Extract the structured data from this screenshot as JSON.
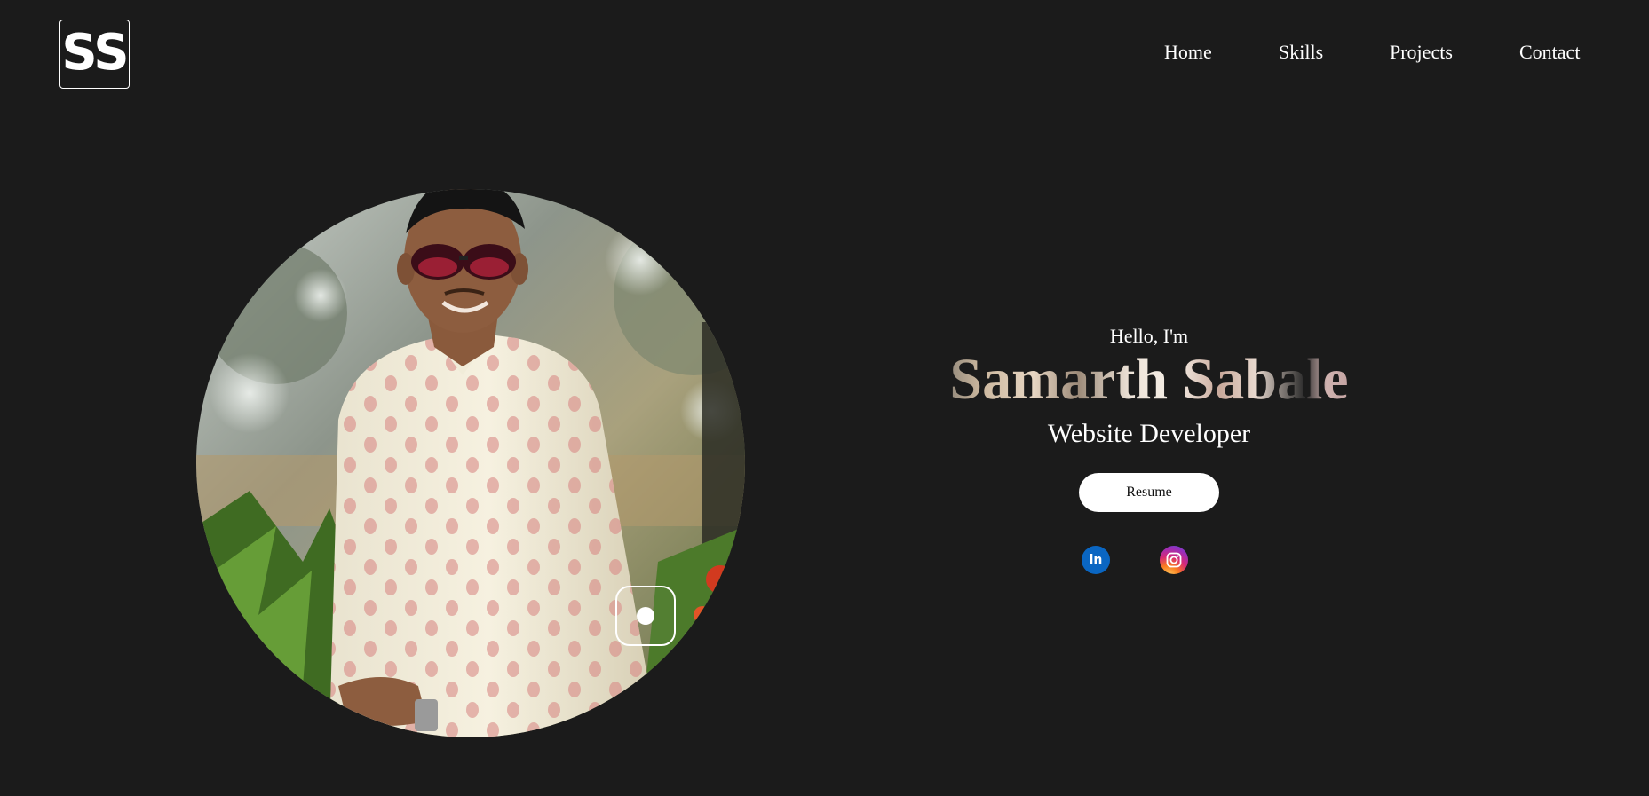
{
  "header": {
    "logo_text": "SS",
    "nav": [
      {
        "label": "Home"
      },
      {
        "label": "Skills"
      },
      {
        "label": "Projects"
      },
      {
        "label": "Contact"
      }
    ]
  },
  "hero": {
    "greeting": "Hello, I'm",
    "name": "Samarth Sabale",
    "role": "Website Developer",
    "resume_label": "Resume",
    "portrait_icon": "portrait-photo",
    "social": [
      {
        "icon": "linkedin-icon",
        "label": "in",
        "color": "#0a66c2"
      },
      {
        "icon": "instagram-icon",
        "color": "#d62976"
      }
    ]
  },
  "colors": {
    "background": "#1b1b1b",
    "text": "#ffffff"
  }
}
